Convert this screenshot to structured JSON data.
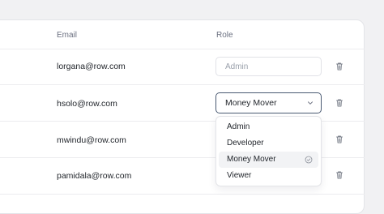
{
  "table": {
    "headers": {
      "email": "Email",
      "role": "Role"
    },
    "rows": [
      {
        "email": "lorgana@row.com",
        "role_placeholder": "Admin"
      },
      {
        "email": "hsolo@row.com",
        "role_value": "Money Mover"
      },
      {
        "email": "mwindu@row.com"
      },
      {
        "email": "pamidala@row.com"
      }
    ]
  },
  "dropdown": {
    "options": [
      "Admin",
      "Developer",
      "Money Mover",
      "Viewer"
    ],
    "selected": "Money Mover"
  },
  "icons": {
    "delete": "trash-icon",
    "select": "chevron-down-icon",
    "selected": "check-circle-icon"
  },
  "colors": {
    "focus_border": "#4a5a72",
    "selected_bg": "#f2f3f5"
  }
}
